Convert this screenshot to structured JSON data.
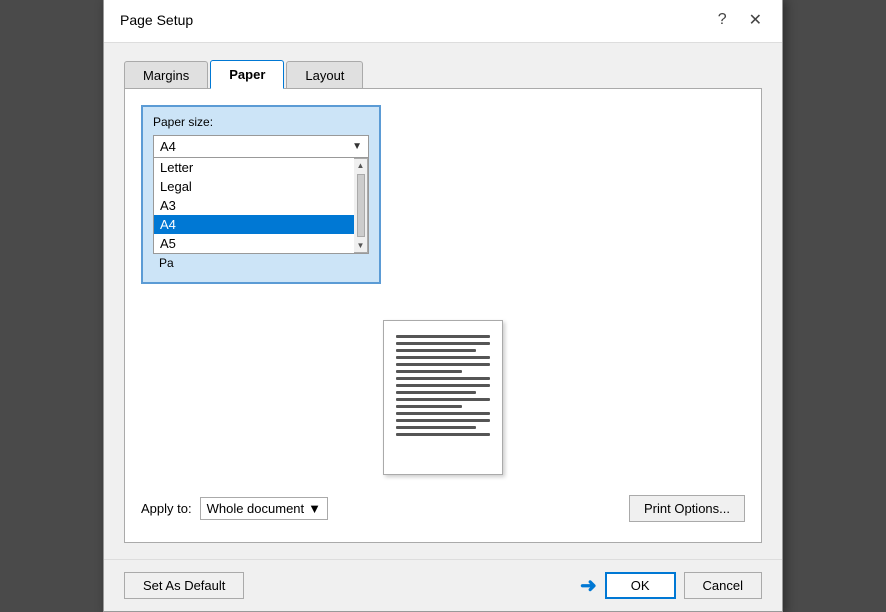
{
  "dialog": {
    "title": "Page Setup",
    "help_label": "?",
    "close_label": "✕"
  },
  "tabs": [
    {
      "id": "margins",
      "label": "Margins",
      "active": false
    },
    {
      "id": "paper",
      "label": "Paper",
      "active": true
    },
    {
      "id": "layout",
      "label": "Layout",
      "active": false
    }
  ],
  "paper_size": {
    "label": "Paper size:",
    "selected": "A4",
    "options": [
      {
        "label": "Letter",
        "selected": false
      },
      {
        "label": "Legal",
        "selected": false
      },
      {
        "label": "A3",
        "selected": false
      },
      {
        "label": "A4",
        "selected": true
      },
      {
        "label": "A5",
        "selected": false
      }
    ]
  },
  "partial_label": "Pa",
  "apply_to": {
    "label": "Apply to:",
    "value": "Whole document"
  },
  "buttons": {
    "set_as_default": "Set As Default",
    "ok": "OK",
    "cancel": "Cancel",
    "print_options": "Print Options..."
  }
}
